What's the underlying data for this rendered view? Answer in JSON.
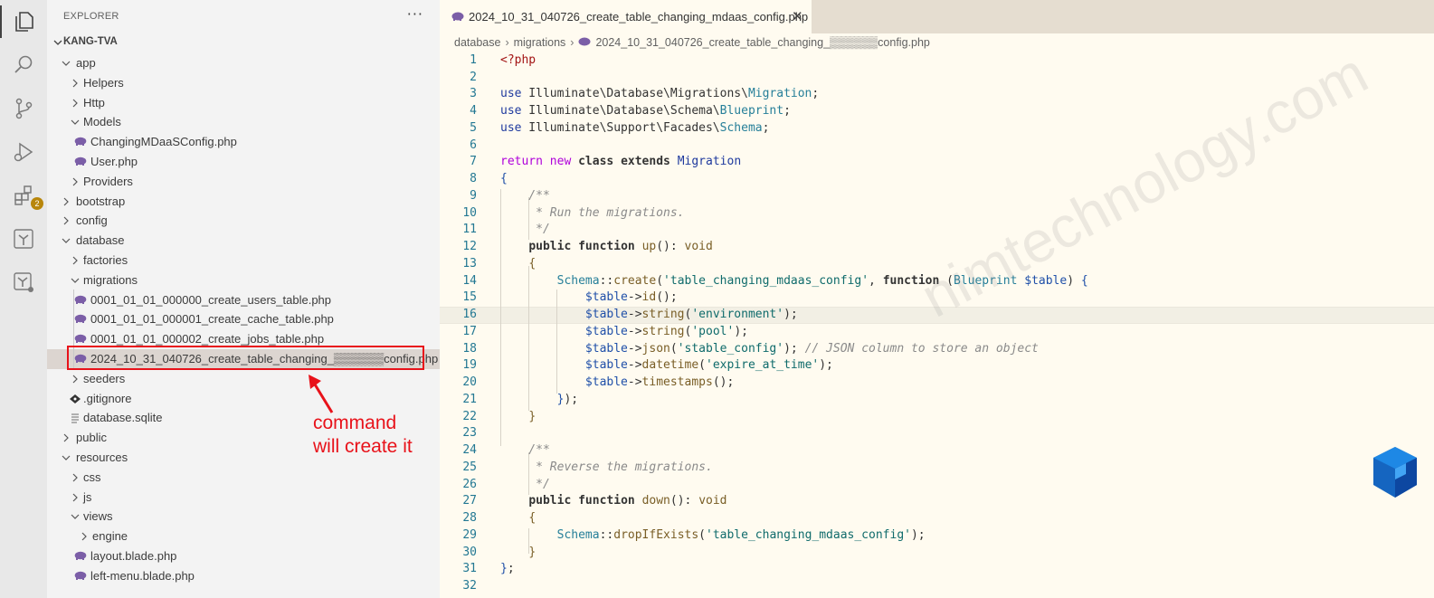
{
  "explorer": {
    "title": "EXPLORER",
    "more_label": "···",
    "section": "KANG-TVA",
    "tree": [
      {
        "label": "app",
        "kind": "folder",
        "open": true,
        "depth": 0
      },
      {
        "label": "Helpers",
        "kind": "folder",
        "open": false,
        "depth": 1
      },
      {
        "label": "Http",
        "kind": "folder",
        "open": false,
        "depth": 1
      },
      {
        "label": "Models",
        "kind": "folder",
        "open": true,
        "depth": 1
      },
      {
        "label": "ChangingMDaaSConfig.php",
        "kind": "php",
        "depth": 2
      },
      {
        "label": "User.php",
        "kind": "php",
        "depth": 2
      },
      {
        "label": "Providers",
        "kind": "folder",
        "open": false,
        "depth": 1
      },
      {
        "label": "bootstrap",
        "kind": "folder",
        "open": false,
        "depth": 0
      },
      {
        "label": "config",
        "kind": "folder",
        "open": false,
        "depth": 0
      },
      {
        "label": "database",
        "kind": "folder",
        "open": true,
        "depth": 0
      },
      {
        "label": "factories",
        "kind": "folder",
        "open": false,
        "depth": 1
      },
      {
        "label": "migrations",
        "kind": "folder",
        "open": true,
        "depth": 1
      },
      {
        "label": "0001_01_01_000000_create_users_table.php",
        "kind": "php",
        "depth": 2
      },
      {
        "label": "0001_01_01_000001_create_cache_table.php",
        "kind": "php",
        "depth": 2
      },
      {
        "label": "0001_01_01_000002_create_jobs_table.php",
        "kind": "php",
        "depth": 2
      },
      {
        "label": "2024_10_31_040726_create_table_changing_▒▒▒▒▒▒config.php",
        "kind": "php",
        "depth": 2,
        "selected": true
      },
      {
        "label": "seeders",
        "kind": "folder",
        "open": false,
        "depth": 1
      },
      {
        "label": ".gitignore",
        "kind": "git",
        "depth": 1
      },
      {
        "label": "database.sqlite",
        "kind": "text",
        "depth": 1
      },
      {
        "label": "public",
        "kind": "folder",
        "open": false,
        "depth": 0
      },
      {
        "label": "resources",
        "kind": "folder",
        "open": true,
        "depth": 0
      },
      {
        "label": "css",
        "kind": "folder",
        "open": false,
        "depth": 1
      },
      {
        "label": "js",
        "kind": "folder",
        "open": false,
        "depth": 1
      },
      {
        "label": "views",
        "kind": "folder",
        "open": true,
        "depth": 1
      },
      {
        "label": "engine",
        "kind": "folder",
        "open": false,
        "depth": 2
      },
      {
        "label": "layout.blade.php",
        "kind": "php",
        "depth": 2
      },
      {
        "label": "left-menu.blade.php",
        "kind": "php",
        "depth": 2
      }
    ]
  },
  "activity_bar": {
    "items": [
      "explorer-icon",
      "search-icon",
      "source-control-icon",
      "run-debug-icon",
      "extensions-icon",
      "remote-tree-icon",
      "remote-tree-alt-icon"
    ],
    "extensions_badge": "2"
  },
  "annotation": {
    "line1": "command",
    "line2": "will create it"
  },
  "editor": {
    "tab_label": "2024_10_31_040726_create_table_changing_mdaas_config.php",
    "close_glyph": "✕",
    "breadcrumbs": [
      "database",
      "migrations",
      "2024_10_31_040726_create_table_changing_▒▒▒▒▒▒config.php"
    ],
    "watermark": "nimtechnology.com",
    "line_numbers": [
      "1",
      "2",
      "3",
      "4",
      "5",
      "6",
      "7",
      "8",
      "9",
      "10",
      "11",
      "12",
      "13",
      "14",
      "15",
      "16",
      "17",
      "18",
      "19",
      "20",
      "21",
      "22",
      "23",
      "24",
      "25",
      "26",
      "27",
      "28",
      "29",
      "30",
      "31",
      "32"
    ],
    "current_line": 16
  },
  "colors": {
    "activity_bg": "#e8e8e8",
    "sidebar_bg": "#f3f3f3",
    "editor_bg": "#fffbf0",
    "highlight": "#e8121a",
    "php_icon": "#7b5ea7"
  }
}
